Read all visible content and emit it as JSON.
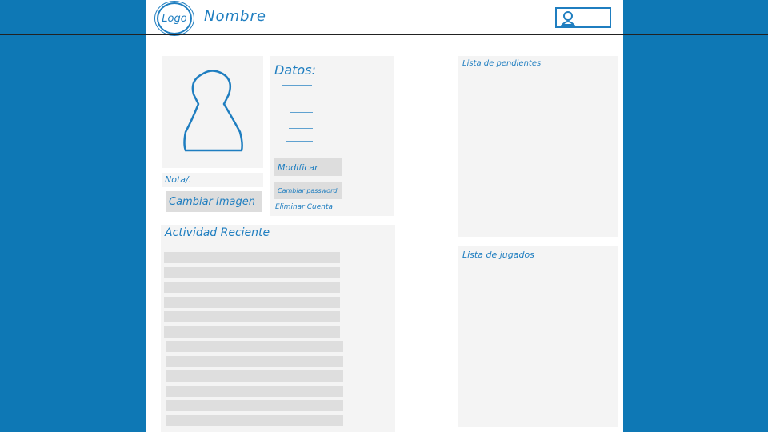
{
  "header": {
    "logo_text": "Logo",
    "site_name": "Nombre",
    "user_button": "user"
  },
  "profile": {
    "avatar_label": "avatar",
    "status_text": "Nota/.",
    "change_image": "Cambiar Imagen"
  },
  "datos": {
    "title": "Datos:",
    "modify": "Modificar",
    "change_password": "Cambiar password",
    "delete_account": "Eliminar Cuenta"
  },
  "activity": {
    "title": "Actividad Reciente",
    "rows": 12
  },
  "sidebar": {
    "pending_title": "Lista de pendientes",
    "played_title": "Lista de jugados"
  }
}
